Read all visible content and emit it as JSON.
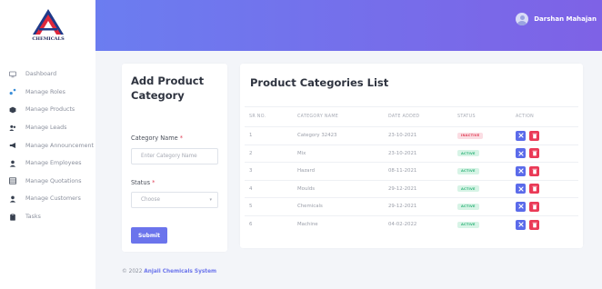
{
  "brand": {
    "logo_text": "CHEMICALS"
  },
  "user": {
    "name": "Darshan Mahajan"
  },
  "sidebar": {
    "items": [
      {
        "label": "Dashboard",
        "icon": "monitor-icon"
      },
      {
        "label": "Manage Roles",
        "icon": "roles-icon"
      },
      {
        "label": "Manage Products",
        "icon": "products-icon"
      },
      {
        "label": "Manage Leads",
        "icon": "leads-icon"
      },
      {
        "label": "Manage Announcement",
        "icon": "megaphone-icon"
      },
      {
        "label": "Manage Employees",
        "icon": "user-icon"
      },
      {
        "label": "Manage Quotations",
        "icon": "table-icon"
      },
      {
        "label": "Manage Customers",
        "icon": "user-icon"
      },
      {
        "label": "Tasks",
        "icon": "clipboard-icon"
      }
    ]
  },
  "form": {
    "title": "Add Product Category",
    "category_label": "Category Name",
    "category_placeholder": "Enter Category Name",
    "status_label": "Status",
    "status_value": "Choose",
    "required_mark": "*",
    "submit_label": "Submit"
  },
  "list": {
    "title": "Product Categories List",
    "columns": [
      "SR NO.",
      "CATEGORY NAME",
      "DATE ADDED",
      "STATUS",
      "ACTION"
    ],
    "rows": [
      {
        "sr": "1",
        "name": "Category 32423",
        "date": "23-10-2021",
        "status": "INACTIVE"
      },
      {
        "sr": "2",
        "name": "Mix",
        "date": "23-10-2021",
        "status": "ACTIVE"
      },
      {
        "sr": "3",
        "name": "Hazard",
        "date": "08-11-2021",
        "status": "ACTIVE"
      },
      {
        "sr": "4",
        "name": "Moulds",
        "date": "29-12-2021",
        "status": "ACTIVE"
      },
      {
        "sr": "5",
        "name": "Chemicals",
        "date": "29-12-2021",
        "status": "ACTIVE"
      },
      {
        "sr": "6",
        "name": "Machine",
        "date": "04-02-2022",
        "status": "ACTIVE"
      }
    ]
  },
  "footer": {
    "copyright": "© 2022",
    "company": "Anjali Chemicals System"
  },
  "colors": {
    "accent": "#6b74ec",
    "active": "#31b37a",
    "inactive": "#e0445a",
    "danger": "#ea3a57"
  }
}
